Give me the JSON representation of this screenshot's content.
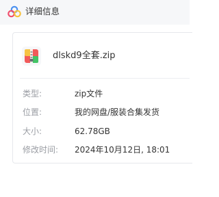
{
  "header": {
    "title": "详细信息",
    "icon": "cloud-logo-icon"
  },
  "file": {
    "name": "dlskd9全套.zip",
    "icon": "zip-archive-icon"
  },
  "details": {
    "type_label": "类型:",
    "type_value": "zip文件",
    "location_label": "位置:",
    "location_value": "我的网盘/服装合集发货",
    "size_label": "大小:",
    "size_value": "62.78GB",
    "modified_label": "修改时间:",
    "modified_value": "2024年10月12日, 18:01"
  },
  "colors": {
    "header_bg": "#f6f7f9",
    "logo_blue": "#4a90f0",
    "logo_red": "#f0506e",
    "logo_yellow": "#f7c23e",
    "zip_red": "#f25a5a",
    "zip_green": "#43c466",
    "zip_yellow": "#f6c344",
    "label_gray": "#9a9da3",
    "text_dark": "#333333"
  }
}
